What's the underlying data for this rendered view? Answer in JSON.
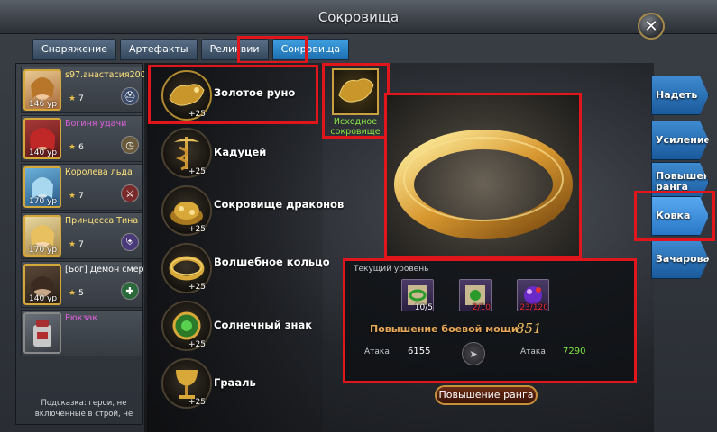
{
  "window": {
    "title": "Сокровища"
  },
  "tabs": [
    {
      "label": "Снаряжение"
    },
    {
      "label": "Артефакты"
    },
    {
      "label": "Реликвии"
    },
    {
      "label": "Сокровища",
      "active": true
    }
  ],
  "heroes": [
    {
      "name": "s97.анастасия200",
      "name_color": "#ffe27a",
      "level": "146 ур",
      "stars": "7",
      "badge_icon": "helmet-icon",
      "badge_color": "#3a4a6a"
    },
    {
      "name": "Богиня удачи",
      "name_color": "#e060e0",
      "level": "140 ур",
      "stars": "6",
      "badge_icon": "clock-icon",
      "badge_color": "#6a5a3a"
    },
    {
      "name": "Королева льда",
      "name_color": "#ffe27a",
      "level": "170 ур",
      "stars": "7",
      "badge_icon": "swords-icon",
      "badge_color": "#7a2a2a"
    },
    {
      "name": "Принцесса Тина",
      "name_color": "#ffe27a",
      "level": "170 ур",
      "stars": "7",
      "badge_icon": "shield-icon",
      "badge_color": "#4a3a7a"
    },
    {
      "name": "[Бог] Демон смерти",
      "name_color": "#f07a30",
      "level": "140 ур",
      "stars": "5",
      "badge_icon": "heal-icon",
      "badge_color": "#2a6a3a"
    }
  ],
  "backpack": {
    "label": "Рюкзак",
    "label_color": "#e060e0"
  },
  "hint": "Подсказка: герои, не включенные в строй, не",
  "treasures": [
    {
      "name": "Золотое руно",
      "plus": "+25",
      "icon": "golden-fleece-icon"
    },
    {
      "name": "Кадуцей",
      "plus": "+25",
      "icon": "caduceus-icon"
    },
    {
      "name": "Сокровище драконов",
      "plus": "+25",
      "icon": "dragon-treasure-icon"
    },
    {
      "name": "Волшебное кольцо",
      "plus": "+25",
      "icon": "magic-ring-icon"
    },
    {
      "name": "Солнечный знак",
      "plus": "+25",
      "icon": "sun-sign-icon"
    },
    {
      "name": "Грааль",
      "plus": "+25",
      "icon": "grail-icon"
    }
  ],
  "source_treasure": {
    "label": "Исходное сокровище"
  },
  "info": {
    "current_level_label": "Текущий уровень",
    "materials": [
      {
        "icon": "scroll-green-icon",
        "count": "10/5",
        "count_color": "#ffffff"
      },
      {
        "icon": "scroll-gem-icon",
        "count": "2/10",
        "count_color": "#e83030"
      },
      {
        "icon": "crystal-orb-icon",
        "count": "23/120",
        "count_color": "#e83030"
      }
    ],
    "power_label": "Повышение боевой мощи",
    "power_value": "851",
    "attack_label_left": "Атака",
    "attack_value_left": "6155",
    "attack_label_right": "Атака",
    "attack_value_right": "7290"
  },
  "rank_up_button": "Повышение ранга",
  "side_buttons": [
    {
      "label": "Надеть"
    },
    {
      "label": "Усиление"
    },
    {
      "label": "Повышение ранга"
    },
    {
      "label": "Ковка",
      "active": true
    },
    {
      "label": "Зачарование"
    }
  ]
}
